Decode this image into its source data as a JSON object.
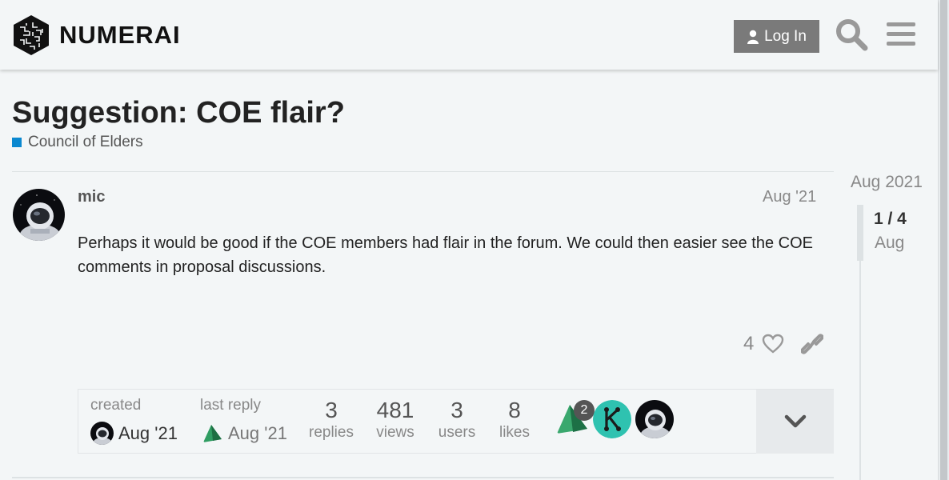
{
  "header": {
    "brand_name": "NUMERAI",
    "login_label": "Log In"
  },
  "topic": {
    "title": "Suggestion: COE flair?",
    "category": "Council of Elders",
    "category_color": "#0a88d0"
  },
  "post": {
    "username": "mic",
    "date": "Aug '21",
    "body": "Perhaps it would be good if the COE members had flair in the forum. We could then easier see the COE comments in proposal discussions.",
    "like_count": "4"
  },
  "topic_map": {
    "created_label": "created",
    "created_date": "Aug '21",
    "last_reply_label": "last reply",
    "last_reply_date": "Aug '21",
    "stats": [
      {
        "value": "3",
        "label": "replies"
      },
      {
        "value": "481",
        "label": "views"
      },
      {
        "value": "3",
        "label": "users"
      },
      {
        "value": "8",
        "label": "likes"
      }
    ],
    "participant_badge": "2"
  },
  "timeline": {
    "start_date": "Aug 2021",
    "position": "1 / 4",
    "current_date": "Aug"
  }
}
